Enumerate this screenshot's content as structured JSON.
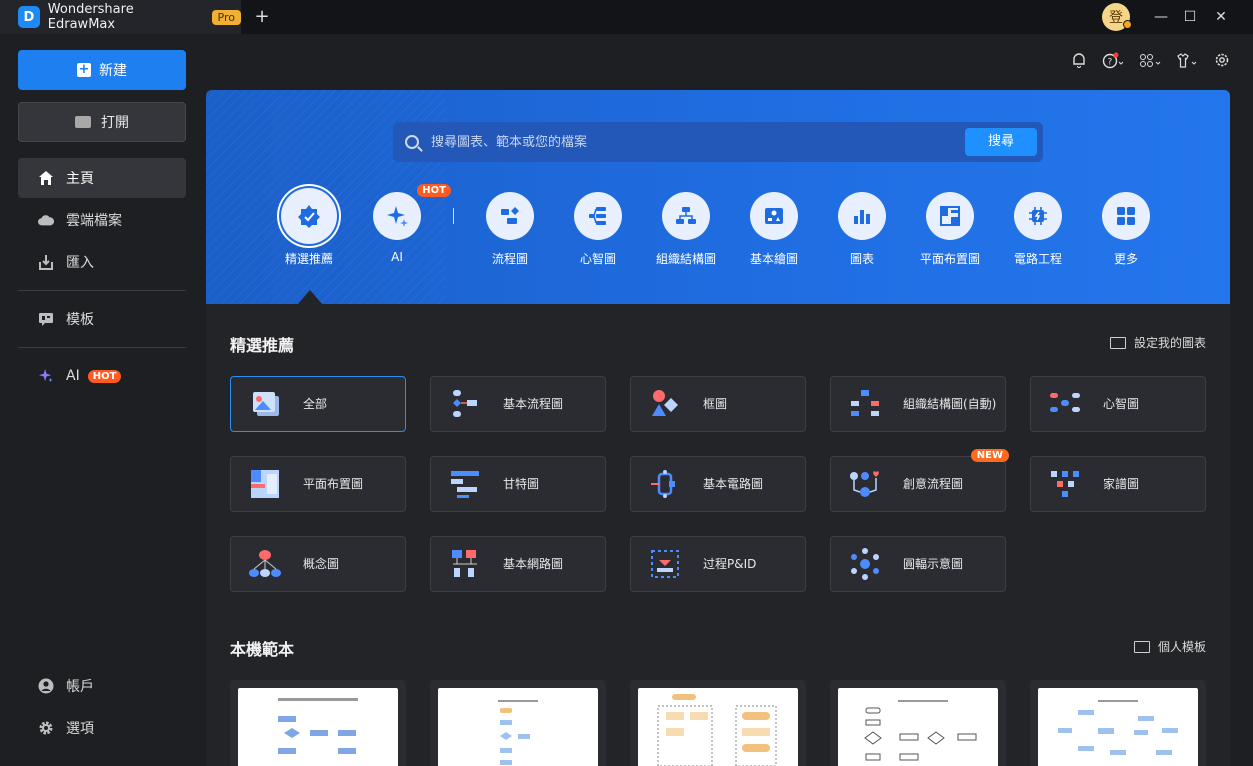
{
  "titlebar": {
    "app_name": "Wondershare EdrawMax",
    "pro_label": "Pro",
    "new_tab": "+",
    "user_initial": "登",
    "minimize": "—",
    "maximize": "☐",
    "close": "✕"
  },
  "sidebar": {
    "new_label": "新建",
    "open_label": "打開",
    "items": [
      {
        "label": "主頁",
        "icon": "home-icon"
      },
      {
        "label": "雲端檔案",
        "icon": "cloud-icon"
      },
      {
        "label": "匯入",
        "icon": "import-icon"
      },
      {
        "label": "模板",
        "icon": "template-icon"
      },
      {
        "label": "AI",
        "icon": "sparkle-icon",
        "badge": "HOT"
      }
    ],
    "bottom": [
      {
        "label": "帳戶",
        "icon": "account-icon"
      },
      {
        "label": "選項",
        "icon": "gear-icon"
      }
    ]
  },
  "hero": {
    "search_placeholder": "搜尋圖表、範本或您的檔案",
    "search_button": "搜尋",
    "categories": [
      {
        "label": "精選推薦",
        "icon": "featured-icon"
      },
      {
        "label": "AI",
        "icon": "ai-sparkle-icon",
        "badge": "HOT"
      },
      {
        "label": "流程圖",
        "icon": "flowchart-icon"
      },
      {
        "label": "心智圖",
        "icon": "mindmap-icon"
      },
      {
        "label": "組織結構圖",
        "icon": "org-chart-icon"
      },
      {
        "label": "基本繪圖",
        "icon": "basic-drawing-icon"
      },
      {
        "label": "圖表",
        "icon": "chart-icon"
      },
      {
        "label": "平面布置圖",
        "icon": "floor-plan-icon"
      },
      {
        "label": "電路工程",
        "icon": "circuit-icon"
      },
      {
        "label": "更多",
        "icon": "more-grid-icon"
      }
    ]
  },
  "featured": {
    "title": "精選推薦",
    "link": "設定我的圖表",
    "cards": [
      {
        "label": "全部"
      },
      {
        "label": "基本流程圖"
      },
      {
        "label": "框圖"
      },
      {
        "label": "組織結構圖(自動)"
      },
      {
        "label": "心智圖"
      },
      {
        "label": "平面布置圖"
      },
      {
        "label": "甘特圖"
      },
      {
        "label": "基本電路圖"
      },
      {
        "label": "創意流程圖",
        "badge": "NEW"
      },
      {
        "label": "家譜圖"
      },
      {
        "label": "概念圖"
      },
      {
        "label": "基本網路圖"
      },
      {
        "label": "过程P&ID"
      },
      {
        "label": "圓輻示意圖"
      }
    ]
  },
  "local_templates": {
    "title": "本機範本",
    "link": "個人模板"
  },
  "colors": {
    "accent": "#1e7ff0",
    "hot": "#ff5a1f",
    "pro": "#f0b034"
  }
}
